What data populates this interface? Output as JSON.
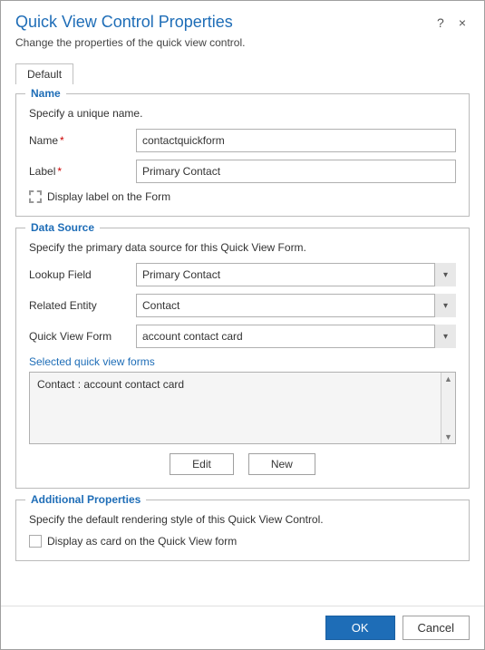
{
  "dialog": {
    "title": "Quick View Control Properties",
    "subtitle": "Change the properties of the quick view control.",
    "help_label": "?",
    "close_label": "×"
  },
  "tabs": {
    "default_label": "Default"
  },
  "name_section": {
    "legend": "Name",
    "description": "Specify a unique name.",
    "name_label": "Name",
    "name_required": "*",
    "name_value": "contactquickform",
    "label_label": "Label",
    "label_required": "*",
    "label_value": "Primary Contact",
    "checkbox_label": "Display label on the Form"
  },
  "datasource_section": {
    "legend": "Data Source",
    "description": "Specify the primary data source for this Quick View Form.",
    "lookup_label": "Lookup Field",
    "lookup_value": "Primary Contact",
    "lookup_options": [
      "Primary Contact"
    ],
    "related_label": "Related Entity",
    "related_value": "Contact",
    "related_options": [
      "Contact"
    ],
    "quickview_label": "Quick View Form",
    "quickview_value": "account contact card",
    "quickview_options": [
      "account contact card"
    ],
    "selected_label": "Selected quick view forms",
    "selected_item": "Contact : account contact card",
    "edit_button": "Edit",
    "new_button": "New"
  },
  "additional_section": {
    "legend": "Additional Properties",
    "description": "Specify the default rendering style of this Quick View Control.",
    "checkbox_label": "Display as card on the Quick View form"
  },
  "footer": {
    "ok_label": "OK",
    "cancel_label": "Cancel"
  }
}
